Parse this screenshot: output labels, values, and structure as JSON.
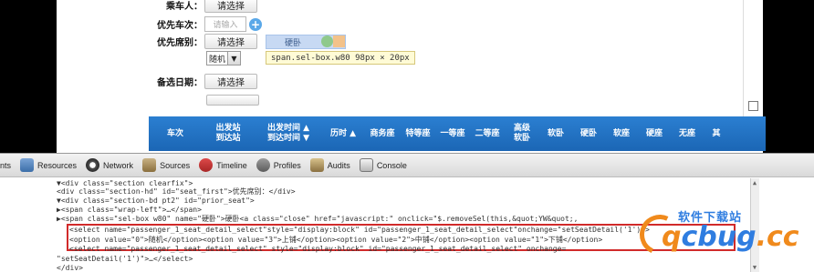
{
  "form": {
    "passenger_label": "乘车人：",
    "passenger_btn": "请选择",
    "priority_train_label": "优先车次：",
    "priority_train_placeholder": "请输入",
    "priority_seat_label": "优先席别：",
    "priority_seat_btn": "请选择",
    "seat_tag_text": "硬卧",
    "seat_small_select": "随机",
    "backup_date_label": "备选日期：",
    "backup_date_btn": "请选择"
  },
  "tooltip": {
    "text": "span.sel-box.w80 98px × 20px"
  },
  "table_header": {
    "columns": [
      {
        "l1": "车次",
        "l2": ""
      },
      {
        "l1": "出发站",
        "l2": "到达站"
      },
      {
        "l1": "出发时间 ▲",
        "l2": "到达时间 ▼"
      },
      {
        "l1": "历时 ▲",
        "l2": ""
      },
      {
        "l1": "商务座",
        "l2": ""
      },
      {
        "l1": "特等座",
        "l2": ""
      },
      {
        "l1": "一等座",
        "l2": ""
      },
      {
        "l1": "二等座",
        "l2": ""
      },
      {
        "l1": "高级",
        "l2": "软卧"
      },
      {
        "l1": "软卧",
        "l2": ""
      },
      {
        "l1": "硬卧",
        "l2": ""
      },
      {
        "l1": "软座",
        "l2": ""
      },
      {
        "l1": "硬座",
        "l2": ""
      },
      {
        "l1": "无座",
        "l2": ""
      },
      {
        "l1": "其",
        "l2": ""
      }
    ]
  },
  "devtools": {
    "tabs": [
      {
        "label": "nts",
        "icon": "elements-icon"
      },
      {
        "label": "Resources",
        "icon": "resources-icon"
      },
      {
        "label": "Network",
        "icon": "network-icon"
      },
      {
        "label": "Sources",
        "icon": "sources-icon"
      },
      {
        "label": "Timeline",
        "icon": "timeline-icon"
      },
      {
        "label": "Profiles",
        "icon": "profiles-icon"
      },
      {
        "label": "Audits",
        "icon": "audits-icon"
      },
      {
        "label": "Console",
        "icon": "console-icon"
      }
    ],
    "code_lines": [
      "  ▼<div class=\"section clearfix\">",
      "    <div class=\"section-hd\" id=\"seat_first\">优先席别：</div>",
      "  ▼<div class=\"section-bd pt2\" id=\"prior_seat\">",
      "    ▶<span class=\"wrap-left\">…</span>",
      "    ▶<span class=\"sel-box w80\" name=\"硬卧\">硬卧<a class=\"close\" href=\"javascript:\" onclick=\"$.removeSel(this,&quot;YW&quot;,",
      "      <select name=\"passenger_1_seat_detail_select\"style=\"display:block\" id=\"passenger_1_seat_detail_select\"onchange=\"setSeatDetail('1')\">",
      "      <option value=\"0\">随机</option><option value=\"3\">上铺</option><option value=\"2\">中铺</option><option value=\"1\">下铺</option>",
      "      <select name=\"passenger_1_seat_detail_select\" style=\"display:block\" id=\"passenger_1_seat_detail_select\" onchange=",
      "   \"setSeatDetail('1')\">…</select>",
      "    </div>"
    ]
  },
  "watermark": {
    "top_text": "软件下载站",
    "main_text_a": "q",
    "main_text_b": "cbug",
    "main_text_c": ".cc"
  },
  "colors": {
    "header_blue": "#1f6fc2",
    "highlight_red": "#d12a2a",
    "tooltip_bg": "#fffbd6"
  }
}
